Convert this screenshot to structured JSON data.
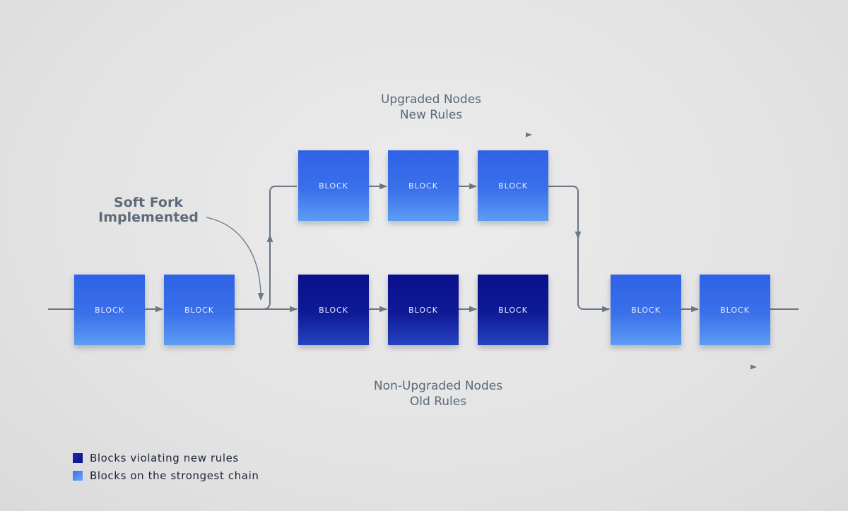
{
  "diagram": {
    "title_upgraded": [
      "Upgraded Nodes",
      "New Rules"
    ],
    "title_non_upgraded": [
      "Non-Upgraded Nodes",
      "Old Rules"
    ],
    "fork_annotation": [
      "Soft Fork",
      "Implemented"
    ],
    "block_label": "BLOCK",
    "colors": {
      "strong_chain_top": "#2f62e6",
      "strong_chain_bottom": "#5c9cf4",
      "violating_top": "#0a0f8c",
      "violating_bottom": "#2542c0",
      "connector": "#6b7784",
      "text": "#5a6878"
    },
    "blocks": [
      {
        "id": "b1",
        "label": "BLOCK",
        "type": "strong",
        "chain": "main"
      },
      {
        "id": "b2",
        "label": "BLOCK",
        "type": "strong",
        "chain": "main"
      },
      {
        "id": "u1",
        "label": "BLOCK",
        "type": "strong",
        "chain": "upgraded"
      },
      {
        "id": "u2",
        "label": "BLOCK",
        "type": "strong",
        "chain": "upgraded"
      },
      {
        "id": "u3",
        "label": "BLOCK",
        "type": "strong",
        "chain": "upgraded"
      },
      {
        "id": "o1",
        "label": "BLOCK",
        "type": "violating",
        "chain": "non-upgraded"
      },
      {
        "id": "o2",
        "label": "BLOCK",
        "type": "violating",
        "chain": "non-upgraded"
      },
      {
        "id": "o3",
        "label": "BLOCK",
        "type": "violating",
        "chain": "non-upgraded"
      },
      {
        "id": "m1",
        "label": "BLOCK",
        "type": "strong",
        "chain": "main"
      },
      {
        "id": "m2",
        "label": "BLOCK",
        "type": "strong",
        "chain": "main"
      }
    ]
  },
  "legend": [
    {
      "label": "Blocks violating new rules",
      "type": "violating"
    },
    {
      "label": "Blocks on the strongest chain",
      "type": "strong"
    }
  ]
}
